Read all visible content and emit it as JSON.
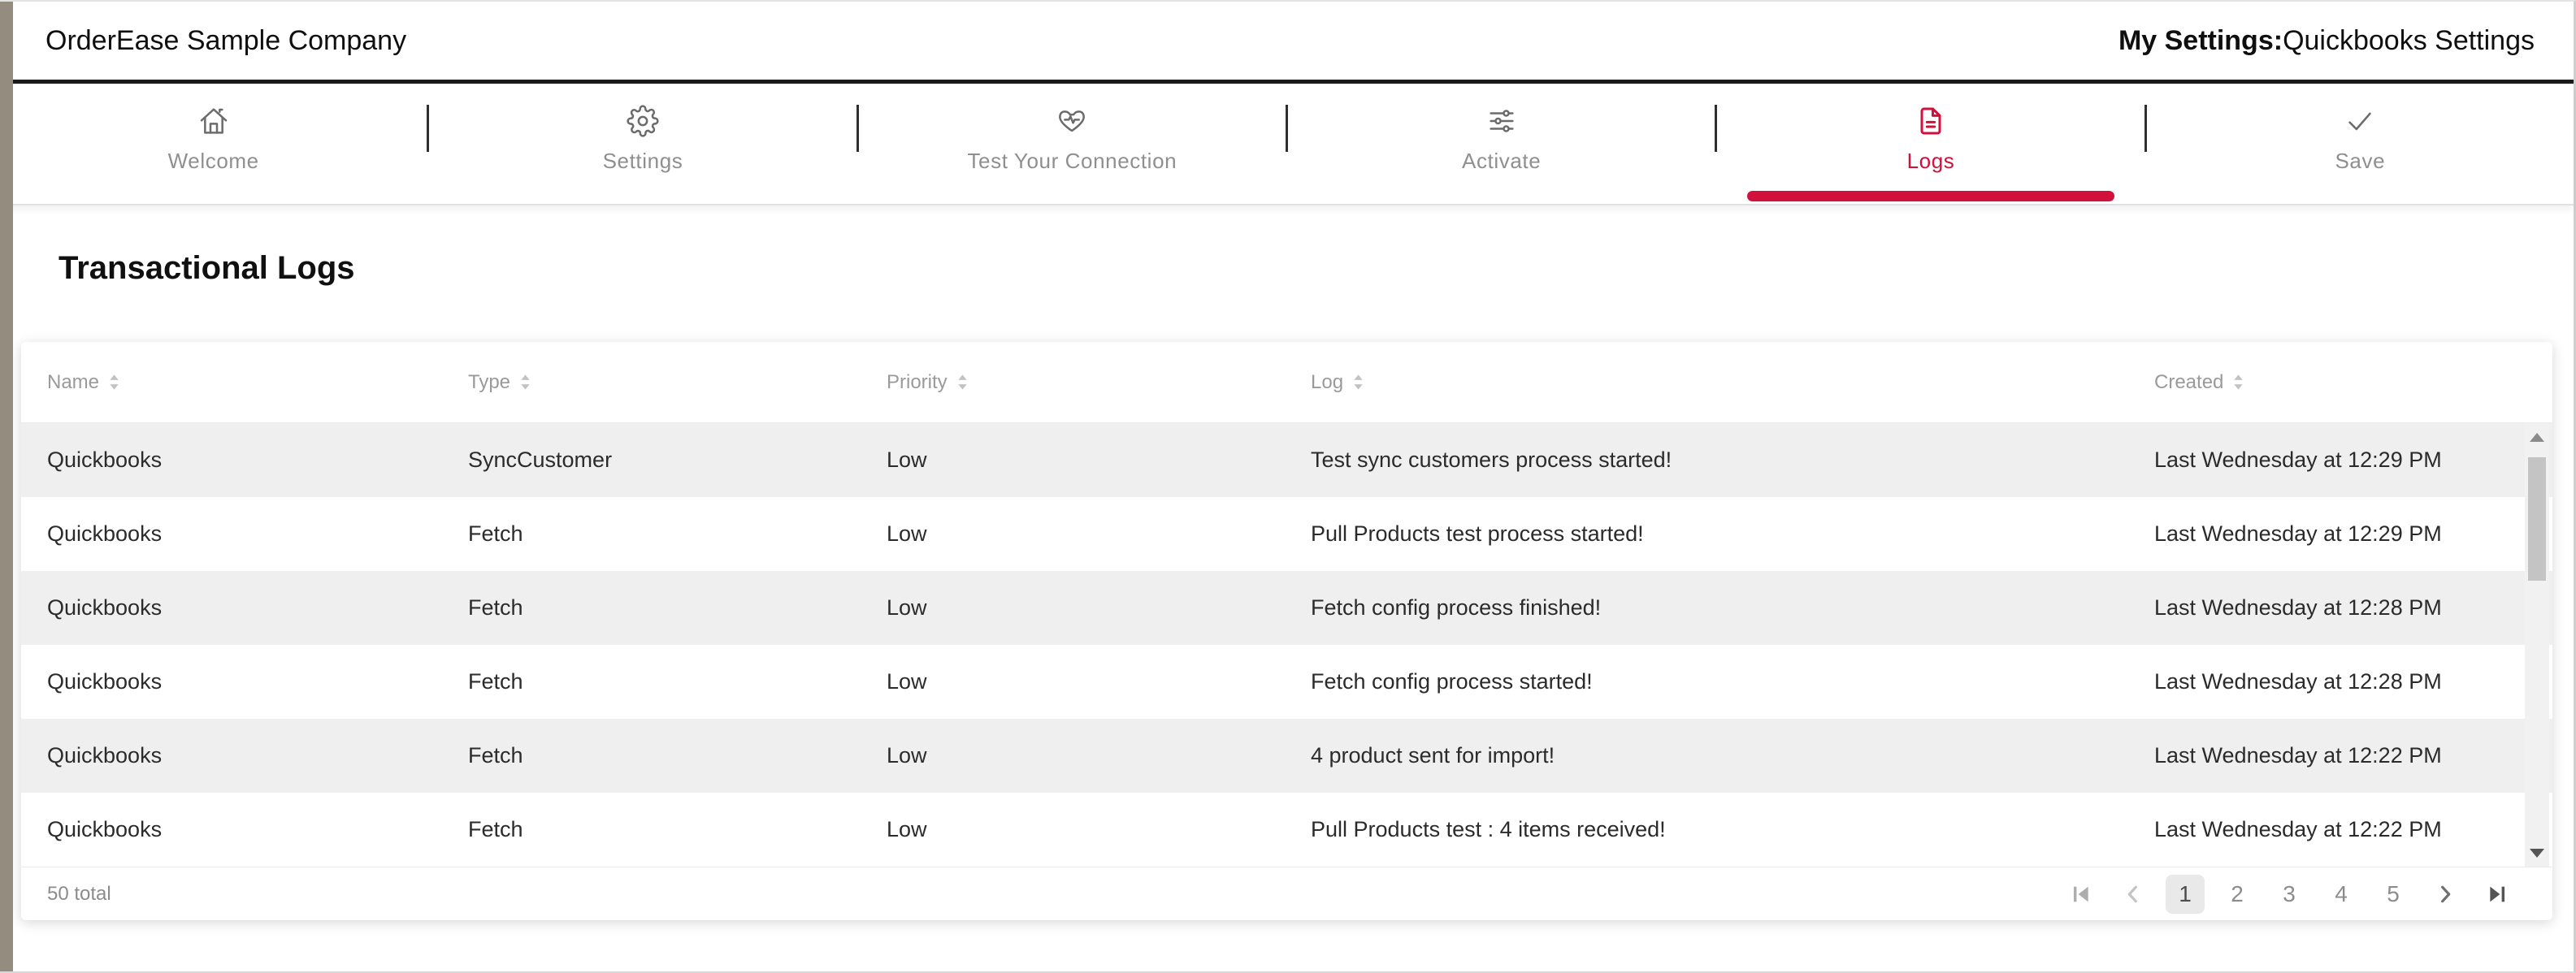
{
  "header": {
    "company": "OrderEase Sample Company",
    "my_settings_label": "My Settings:",
    "my_settings_value": "Quickbooks Settings"
  },
  "tabs": [
    {
      "label": "Welcome",
      "icon": "home-icon",
      "active": false
    },
    {
      "label": "Settings",
      "icon": "gear-icon",
      "active": false
    },
    {
      "label": "Test Your Connection",
      "icon": "heart-pulse-icon",
      "active": false
    },
    {
      "label": "Activate",
      "icon": "sliders-icon",
      "active": false
    },
    {
      "label": "Logs",
      "icon": "document-icon",
      "active": true
    },
    {
      "label": "Save",
      "icon": "check-icon",
      "active": false
    }
  ],
  "content": {
    "title": "Transactional Logs"
  },
  "table": {
    "columns": [
      "Name",
      "Type",
      "Priority",
      "Log",
      "Created"
    ],
    "rows": [
      [
        "Quickbooks",
        "SyncCustomer",
        "Low",
        "Test sync customers process started!",
        "Last Wednesday at 12:29 PM"
      ],
      [
        "Quickbooks",
        "Fetch",
        "Low",
        "Pull Products test process started!",
        "Last Wednesday at 12:29 PM"
      ],
      [
        "Quickbooks",
        "Fetch",
        "Low",
        "Fetch config process finished!",
        "Last Wednesday at 12:28 PM"
      ],
      [
        "Quickbooks",
        "Fetch",
        "Low",
        "Fetch config process started!",
        "Last Wednesday at 12:28 PM"
      ],
      [
        "Quickbooks",
        "Fetch",
        "Low",
        "4 product sent for import!",
        "Last Wednesday at 12:22 PM"
      ],
      [
        "Quickbooks",
        "Fetch",
        "Low",
        "Pull Products test : 4 items received!",
        "Last Wednesday at 12:22 PM"
      ]
    ]
  },
  "pagination": {
    "total": "50 total",
    "pages": [
      "1",
      "2",
      "3",
      "4",
      "5"
    ],
    "active_page": "1"
  },
  "colors": {
    "accent": "#d2103c"
  }
}
